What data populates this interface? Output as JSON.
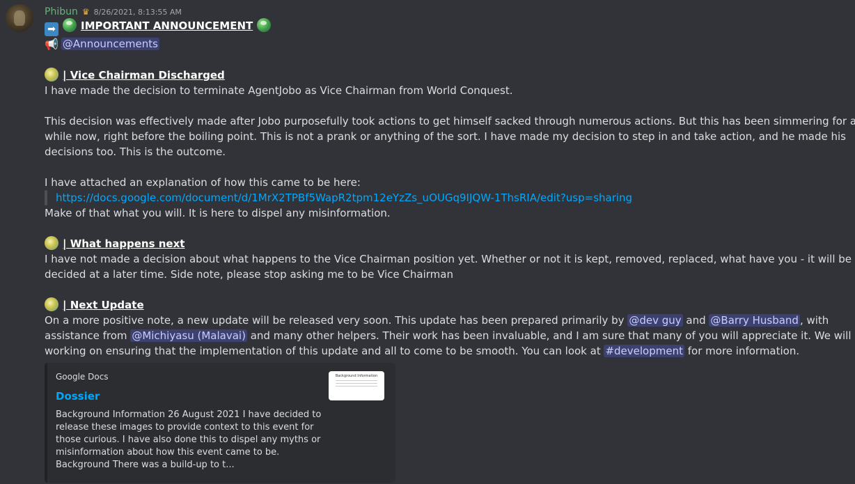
{
  "message": {
    "username": "Phibun",
    "timestamp": "8/26/2021, 8:13:55 AM",
    "announcement_title": "IMPORTANT ANNOUNCEMENT",
    "announcements_mention": "@Announcements",
    "section1": {
      "heading": "Vice Chairman Discharged",
      "p1": "I have made the decision to terminate AgentJobo as Vice Chairman from World Conquest.",
      "p2_l1": "This decision was effectively made after Jobo purposefully took actions to get himself sacked through numerous actions. But this has been simmering for a",
      "p2_l2": "while now, right before the boiling point. This is not a prank or anything of the sort. I have made my decision to step in and take action, and he made his",
      "p2_l3": "decisions too. This is the outcome.",
      "p3": "I have attached an explanation of how this came to be here:",
      "quote_link": "https://docs.google.com/document/d/1MrX2TPBf5WapR2tpm12eYzZs_uOUGq9IJQW-1ThsRIA/edit?usp=sharing",
      "p4": "Make of that what you will. It is here to dispel any misinformation."
    },
    "section2": {
      "heading": "What happens next",
      "l1": "I have not made a decision about what happens to the Vice Chairman position yet. Whether or not it is kept, removed, replaced, what have you - it will be",
      "l2": "decided at a later time. Side note, please stop asking me to be Vice Chairman"
    },
    "section3": {
      "heading": "Next Update",
      "l1_a": "On a more positive note, a new update will be released very soon. This update has been prepared primarily by ",
      "mention_dev": "@dev guy",
      "l1_b": " and ",
      "mention_barry": "@Barry Husband",
      "l1_c": ", with",
      "l2_a": "assistance from ",
      "mention_michi": "@Michiyasu (Malavai)",
      "l2_b": " and many other helpers. Their work has been invaluable, and I am sure that many of you will appreciate it. We will be",
      "l3_a": "working on ensuring that the implementation of this update and all to come to be smooth. You can look at ",
      "channel": "#development",
      "l3_b": " for more information."
    }
  },
  "embed": {
    "provider": "Google Docs",
    "title": "Dossier",
    "description": "Background Information 26 August 2021 I have decided to release these images to provide context to this event for those curious. I have also done this to dispel any myths or misinformation about how this event came to be. Background There was a build-up to t...",
    "thumb_title": "Background Information"
  },
  "icons": [
    "arrow-right-icon",
    "globe-icon",
    "megaphone-icon",
    "sun-emblem-icon"
  ],
  "colors": {
    "background": "#323338",
    "username": "#68b37a",
    "link": "#00a8fc",
    "mention_bg": "rgba(88,101,242,0.30)",
    "crown": "#f0b232"
  }
}
